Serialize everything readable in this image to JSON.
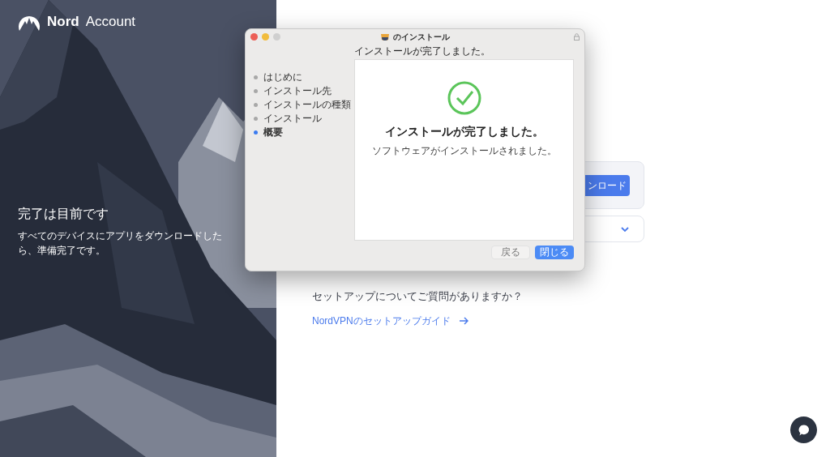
{
  "brand": {
    "name": "Nord",
    "product": "Account"
  },
  "hero": {
    "title": "完了は目前です",
    "text": "すべてのデバイスにアプリをダウンロードしたら、準備完了です。"
  },
  "download_card": {
    "button": "ンロード"
  },
  "expand_card": {
    "expanded": false
  },
  "help": {
    "question": "セットアップについてご質問がありますか？",
    "link": "NordVPNのセットアップガイド"
  },
  "installer": {
    "title": "のインストール",
    "heading": "インストールが完了しました。",
    "steps": [
      {
        "label": "はじめに",
        "selected": false
      },
      {
        "label": "インストール先",
        "selected": false
      },
      {
        "label": "インストールの種類",
        "selected": false
      },
      {
        "label": "インストール",
        "selected": false
      },
      {
        "label": "概要",
        "selected": true
      }
    ],
    "message": "インストールが完了しました。",
    "detail": "ソフトウェアがインストールされました。",
    "buttons": [
      {
        "label": "戻る",
        "disabled": true
      },
      {
        "label": "閉じる",
        "disabled": false
      }
    ]
  }
}
